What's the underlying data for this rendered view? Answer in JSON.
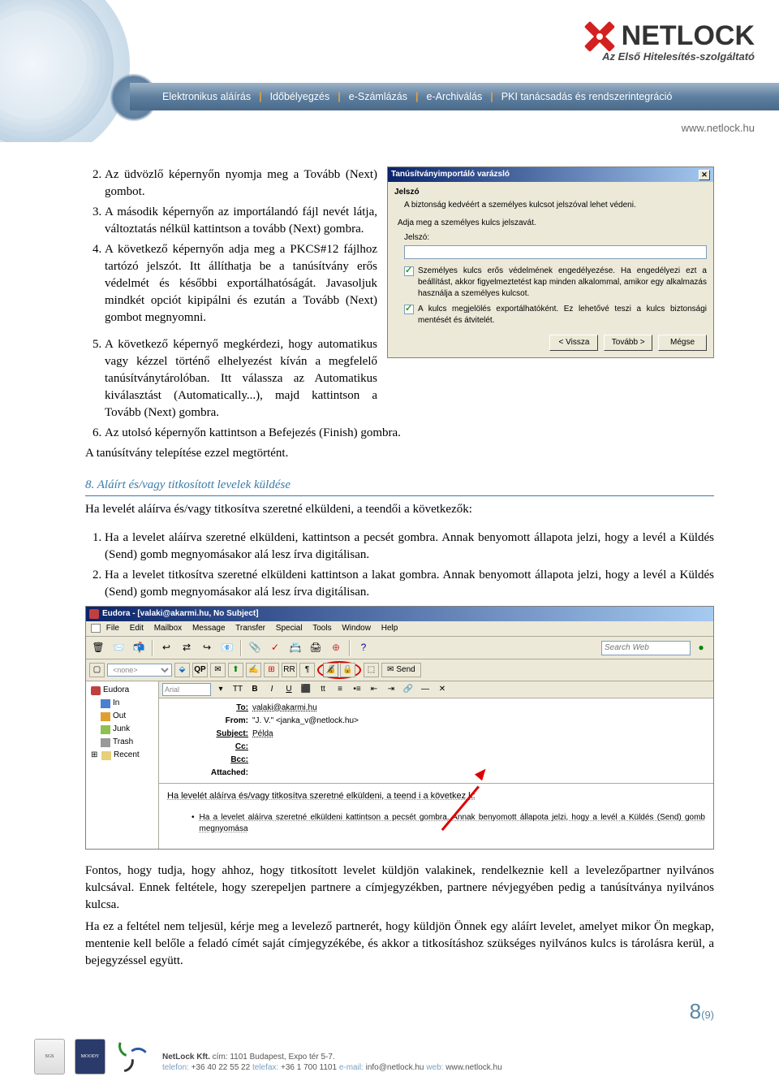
{
  "header": {
    "logo_text": "NETLOCK",
    "logo_tagline": "Az Első Hitelesítés-szolgáltató",
    "nav": [
      "Elektronikus aláírás",
      "Időbélyegzés",
      "e-Számlázás",
      "e-Archiválás",
      "PKI tanácsadás és rendszerintegráció"
    ],
    "url": "www.netlock.hu"
  },
  "body": {
    "li2": "Az üdvözlő képernyőn nyomja meg a Tovább (Next) gombot.",
    "li3": "A második képernyőn az importálandó fájl nevét látja, változtatás nélkül kattintson a tovább (Next) gombra.",
    "li4": "A következő képernyőn adja meg a PKCS#12 fájlhoz tartózó jelszót. Itt állíthatja be a tanúsítvány erős védelmét és későbbi exportálhatóságát. Javasoljuk mindkét opciót kipipálni és ezután a Tovább (Next) gombot megnyomni.",
    "li5": "A következő képernyő megkérdezi, hogy automatikus vagy kézzel történő elhelyezést kíván a megfelelő tanúsítványtárolóban. Itt válassza az Automatikus kiválasztást (Automatically...), majd kattintson a Tovább (Next) gombra.",
    "li6": "Az utolsó képernyőn kattintson a Befejezés (Finish) gombra.",
    "after_list": "A tanúsítvány telepítése ezzel megtörtént.",
    "section8_num": "8.",
    "section8_title": "Aláírt és/vagy titkosított levelek küldése",
    "section8_intro": "Ha levelét aláírva és/vagy titkosítva szeretné elküldeni, a teendői a következők:",
    "li_s1": "Ha a levelet aláírva szeretné elküldeni, kattintson a pecsét gombra. Annak benyomott állapota jelzi, hogy a levél a Küldés (Send) gomb megnyomásakor alá lesz írva digitálisan.",
    "li_s2": "Ha a levelet titkosítva szeretné elküldeni kattintson a lakat gombra. Annak benyomott állapota jelzi, hogy a levél a Küldés (Send) gomb megnyomásakor alá lesz írva digitálisan.",
    "p_foot1": "Fontos, hogy tudja, hogy ahhoz, hogy titkosított levelet küldjön valakinek, rendelkeznie kell a levelezőpartner nyilvános kulcsával. Ennek feltétele, hogy szerepeljen partnere a címjegyzékben, partnere névjegyében pedig a tanúsítványa nyilvános kulcsa.",
    "p_foot2": "Ha ez a feltétel nem teljesül, kérje meg a levelező partnerét, hogy küldjön Önnek egy aláírt levelet, amelyet mikor Ön megkap, mentenie kell belőle a feladó címét saját címjegyzékébe, és akkor a titkosításhoz szükséges nyilvános kulcs is tárolásra kerül, a bejegyzéssel együtt."
  },
  "dialog": {
    "title": "Tanúsítványimportáló varázsló",
    "grp": "Jelszó",
    "line1": "A biztonság kedvéért a személyes kulcsot jelszóval lehet védeni.",
    "line2": "Adja meg a személyes kulcs jelszavát.",
    "label_pw": "Jelszó:",
    "chk1": "Személyes kulcs erős védelmének engedélyezése. Ha engedélyezi ezt a beállítást, akkor figyelmeztetést kap minden alkalommal, amikor egy alkalmazás használja a személyes kulcsot.",
    "chk2": "A kulcs megjelölés exportálhatóként. Ez lehetővé teszi a kulcs biztonsági mentését és átvitelét.",
    "btn_back": "< Vissza",
    "btn_next": "Tovább >",
    "btn_cancel": "Mégse"
  },
  "eudora": {
    "title": "Eudora - [valaki@akarmi.hu, No Subject]",
    "menus": [
      "File",
      "Edit",
      "Mailbox",
      "Message",
      "Transfer",
      "Special",
      "Tools",
      "Window",
      "Help"
    ],
    "search_ph": "Search Web",
    "dropdown_none": "<none>",
    "send": "Send",
    "tree": {
      "root": "Eudora",
      "in": "In",
      "out": "Out",
      "junk": "Junk",
      "trash": "Trash",
      "recent": "Recent"
    },
    "fmt_combo": "Arial",
    "hdr": {
      "to_l": "To:",
      "to_v": "valaki@akarmi.hu",
      "from_l": "From:",
      "from_v": "\"J. V.\" <janka_v@netlock.hu>",
      "subj_l": "Subject:",
      "subj_v": "Példa",
      "cc_l": "Cc:",
      "bcc_l": "Bcc:",
      "att_l": "Attached:"
    },
    "msg1": "Ha levelét aláírva és/vagy titkosítva szeretné elküldeni, a teend i a következ k:",
    "msg2": "Ha a levelet aláírva szeretné elküldeni kattintson a pecsét gombra. Annak benyomott állapota jelzi, hogy a levél a Küldés (Send) gomb megnyomása"
  },
  "page": {
    "num": "8",
    "total": "(9)"
  },
  "footer": {
    "line1a": "NetLock Kft.",
    "line1b": " cím: 1101 Budapest, Expo tér 5-7.",
    "line2_tel_l": "telefon: ",
    "line2_tel": "+36 40 22 55 22",
    "line2_fax_l": " telefax: ",
    "line2_fax": "+36 1 700 1101",
    "line2_em_l": " e-mail: ",
    "line2_em": "info@netlock.hu",
    "line2_web_l": " web: ",
    "line2_web": "www.netlock.hu",
    "badge1": "SGS",
    "badge2": "MOODY"
  }
}
